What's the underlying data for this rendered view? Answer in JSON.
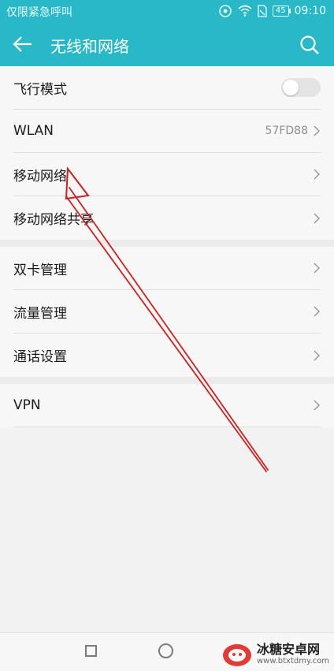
{
  "status_bar": {
    "carrier_text": "仅限紧急呼叫",
    "battery": "45",
    "time": "09:10"
  },
  "header": {
    "title": "无线和网络"
  },
  "groups": [
    {
      "items": [
        {
          "label": "飞行模式",
          "toggle_on": false
        },
        {
          "label": "WLAN",
          "value": "57FD88"
        },
        {
          "label": "移动网络"
        },
        {
          "label": "移动网络共享"
        }
      ]
    },
    {
      "items": [
        {
          "label": "双卡管理"
        },
        {
          "label": "流量管理"
        },
        {
          "label": "通话设置"
        }
      ]
    },
    {
      "items": [
        {
          "label": "VPN"
        }
      ]
    }
  ],
  "watermark": {
    "main": "冰糖安卓网",
    "sub": "www.btxtdmy.com"
  },
  "colors": {
    "accent": "#29b8c8",
    "arrow": "#d11f1f"
  }
}
